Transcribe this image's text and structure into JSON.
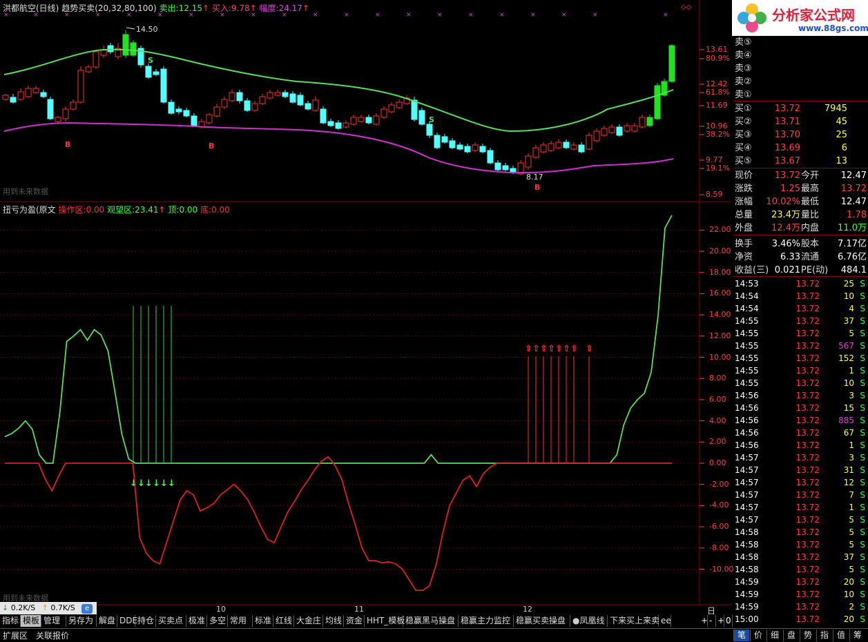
{
  "upper_header": {
    "name": "洪都航空(日线)",
    "indicator": "趋势买卖(20,32,80,100)",
    "sell_label": "卖出:",
    "sell_value": "12.15",
    "buy_label": "买入:",
    "buy_value": "9.78",
    "amp_label": "幅度:",
    "amp_value": "24.17"
  },
  "upper_axis": [
    {
      "label": "13.61",
      "y": 72
    },
    {
      "label": "80.9%",
      "y": 85
    },
    {
      "label": "12.42",
      "y": 122
    },
    {
      "label": "61.8%",
      "y": 134
    },
    {
      "label": "11.69",
      "y": 153
    },
    {
      "label": "10.96",
      "y": 183
    },
    {
      "label": "38.2%",
      "y": 195
    },
    {
      "label": "9.77",
      "y": 232
    },
    {
      "label": "19.1%",
      "y": 244
    },
    {
      "label": "8.59",
      "y": 282
    }
  ],
  "upper_marks": {
    "high_label": "14.50",
    "low_label": "8.17",
    "buy_mark": "B",
    "sell_mark": "S",
    "watermark": "用到未来数据"
  },
  "lower_header": {
    "name": "扭亏为盈(原文",
    "op_label": "操作区:",
    "op_value": "0.00",
    "watch_label": "观望区:",
    "watch_value": "23.41",
    "top_label": "顶:",
    "top_value": "0.00",
    "bottom_label": "底:",
    "bottom_value": "0.00"
  },
  "lower_axis": [
    "22.00",
    "20.00",
    "18.00",
    "16.00",
    "14.00",
    "12.00",
    "10.00",
    "8.00",
    "6.00",
    "4.00",
    "2.00",
    "0.00",
    "-2.00",
    "-4.00",
    "-6.00",
    "-8.00",
    "-10.00"
  ],
  "lower_watermark": "用到未来数据",
  "chart_data": {
    "type": "line",
    "title": "扭亏为盈(原文",
    "series": [
      {
        "name": "观望区",
        "color": "#55e055",
        "values": [
          2.5,
          2.8,
          3.3,
          4,
          3.2,
          0.8,
          0,
          0,
          4.8,
          11.5,
          12,
          12.6,
          11.6,
          12.6,
          12.1,
          10.6,
          6.8,
          2.8,
          0.4,
          0,
          0,
          0,
          0,
          0,
          0,
          0,
          0,
          0,
          0,
          0,
          0,
          0,
          0,
          0,
          0,
          0,
          0,
          0,
          0,
          0,
          0,
          0,
          0,
          0,
          0,
          0,
          0,
          0,
          0,
          0,
          0,
          0,
          0,
          0,
          0,
          0,
          0,
          0,
          0,
          0,
          0,
          0,
          0.8,
          0,
          0,
          0,
          0,
          0,
          0,
          0,
          0,
          0,
          0,
          0,
          0,
          0,
          0,
          0,
          0,
          0,
          0,
          0,
          0,
          0,
          0,
          0,
          0,
          0,
          0,
          0.8,
          3.6,
          5.2,
          6,
          6.6,
          8.6,
          14,
          22.2,
          23.4
        ]
      },
      {
        "name": "操作区",
        "color": "#e02020",
        "values": [
          0,
          0,
          0,
          0,
          0,
          0,
          -1.5,
          -2.6,
          -1.2,
          0,
          0,
          0,
          0,
          0,
          0,
          0,
          0,
          0,
          0,
          0,
          -7,
          -8.5,
          -9.2,
          -9.5,
          -7.5,
          -5.5,
          -3.5,
          -2.6,
          -3,
          -4.5,
          -4.2,
          -3.8,
          -3,
          -2.5,
          -2,
          -2.6,
          -3.4,
          -4.6,
          -6,
          -7.2,
          -7.5,
          -6,
          -4.6,
          -3.6,
          -2.5,
          -1.6,
          -0.6,
          0.2,
          0.6,
          -0.2,
          -1.5,
          -3.8,
          -5.8,
          -8,
          -9.2,
          -9.2,
          -9.4,
          -9.3,
          -9.5,
          -10,
          -11,
          -12,
          -12,
          -11.6,
          -9.6,
          -6.6,
          -4,
          -2.8,
          -1.6,
          -1.2,
          -2.2,
          -1,
          -0.4,
          0,
          0,
          0,
          0,
          0,
          0,
          0,
          0,
          0,
          0,
          0,
          0,
          0,
          0,
          0,
          0,
          0,
          0,
          0,
          0,
          0,
          0,
          0,
          0,
          0,
          0,
          0
        ]
      }
    ],
    "ylim": [
      -12,
      24
    ],
    "sell_signal_count": 6,
    "buy_signal_count": 9
  },
  "right_panel": {
    "sell_orders": [
      "卖⑤",
      "卖④",
      "卖③",
      "卖②",
      "卖①"
    ],
    "buy_orders": [
      {
        "label": "买①",
        "price": "13.72",
        "vol": "7945"
      },
      {
        "label": "买②",
        "price": "13.71",
        "vol": "45"
      },
      {
        "label": "买③",
        "price": "13.70",
        "vol": "25"
      },
      {
        "label": "买④",
        "price": "13.69",
        "vol": "6"
      },
      {
        "label": "买⑤",
        "price": "13.67",
        "vol": "13"
      }
    ],
    "stats": [
      {
        "l1": "现价",
        "v1": "13.72",
        "c1": "#ff4040",
        "l2": "今开",
        "v2": "12.47",
        "c2": "#ffffff"
      },
      {
        "l1": "涨跌",
        "v1": "1.25",
        "c1": "#ff4040",
        "l2": "最高",
        "v2": "13.72",
        "c2": "#ff4040"
      },
      {
        "l1": "涨幅",
        "v1": "10.02%",
        "c1": "#ff4040",
        "l2": "最低",
        "v2": "12.47",
        "c2": "#ffffff"
      },
      {
        "l1": "总量",
        "v1": "23.4万",
        "c1": "#ffff40",
        "l2": "量比",
        "v2": "1.78",
        "c2": "#ff4040"
      },
      {
        "l1": "外盘",
        "v1": "12.4万",
        "c1": "#ff4040",
        "l2": "内盘",
        "v2": "11.0万",
        "c2": "#40ff40"
      },
      {
        "l1": "换手",
        "v1": "3.46%",
        "c1": "#ffffff",
        "l2": "股本",
        "v2": "7.17亿",
        "c2": "#ffffff"
      },
      {
        "l1": "净资",
        "v1": "6.33",
        "c1": "#ffffff",
        "l2": "流通",
        "v2": "6.76亿",
        "c2": "#ffffff"
      },
      {
        "l1": "收益(三)",
        "v1": "0.021",
        "c1": "#ffffff",
        "l2": "PE(动)",
        "v2": "484.1",
        "c2": "#ffffff"
      }
    ],
    "ticks": [
      {
        "t": "14:53",
        "p": "13.72",
        "v": "25",
        "vc": "#ffff40"
      },
      {
        "t": "14:54",
        "p": "13.72",
        "v": "10",
        "vc": "#ffff40"
      },
      {
        "t": "14:54",
        "p": "13.72",
        "v": "4",
        "vc": "#ffff40"
      },
      {
        "t": "14:55",
        "p": "13.72",
        "v": "37",
        "vc": "#ffff40"
      },
      {
        "t": "14:55",
        "p": "13.72",
        "v": "5",
        "vc": "#ffff40"
      },
      {
        "t": "14:55",
        "p": "13.72",
        "v": "567",
        "vc": "#e040e0"
      },
      {
        "t": "14:55",
        "p": "13.72",
        "v": "152",
        "vc": "#ffff40"
      },
      {
        "t": "14:55",
        "p": "13.72",
        "v": "1",
        "vc": "#ffff40"
      },
      {
        "t": "14:55",
        "p": "13.72",
        "v": "10",
        "vc": "#ffff40"
      },
      {
        "t": "14:56",
        "p": "13.72",
        "v": "3",
        "vc": "#ffff40"
      },
      {
        "t": "14:56",
        "p": "13.72",
        "v": "15",
        "vc": "#ffff40"
      },
      {
        "t": "14:56",
        "p": "13.72",
        "v": "885",
        "vc": "#e040e0"
      },
      {
        "t": "14:56",
        "p": "13.72",
        "v": "67",
        "vc": "#ffff40"
      },
      {
        "t": "14:56",
        "p": "13.72",
        "v": "1",
        "vc": "#ffff40"
      },
      {
        "t": "14:57",
        "p": "13.72",
        "v": "3",
        "vc": "#ffff40"
      },
      {
        "t": "14:57",
        "p": "13.72",
        "v": "31",
        "vc": "#ffff40"
      },
      {
        "t": "14:57",
        "p": "13.72",
        "v": "12",
        "vc": "#ffff40"
      },
      {
        "t": "14:57",
        "p": "13.72",
        "v": "7",
        "vc": "#ffff40"
      },
      {
        "t": "14:57",
        "p": "13.72",
        "v": "1",
        "vc": "#ffff40"
      },
      {
        "t": "14:57",
        "p": "13.72",
        "v": "5",
        "vc": "#ffff40"
      },
      {
        "t": "14:58",
        "p": "13.72",
        "v": "5",
        "vc": "#ffff40"
      },
      {
        "t": "14:58",
        "p": "13.72",
        "v": "5",
        "vc": "#ffff40"
      },
      {
        "t": "14:58",
        "p": "13.72",
        "v": "37",
        "vc": "#ffff40"
      },
      {
        "t": "14:58",
        "p": "13.72",
        "v": "5",
        "vc": "#ffff40"
      },
      {
        "t": "14:59",
        "p": "13.72",
        "v": "20",
        "vc": "#ffff40"
      },
      {
        "t": "14:59",
        "p": "13.72",
        "v": "10",
        "vc": "#ffff40"
      },
      {
        "t": "14:59",
        "p": "13.72",
        "v": "2",
        "vc": "#ffff40"
      },
      {
        "t": "15:00",
        "p": "13.72",
        "v": "20",
        "vc": "#ffff40"
      }
    ],
    "tick_flag": "S"
  },
  "date_labels": [
    "10",
    "11",
    "12"
  ],
  "period_label": "日线",
  "speed": {
    "down": "0.2K/S",
    "up": "0.7K/S"
  },
  "tabs": [
    "指标",
    "模板",
    "管理",
    "另存为",
    "解盘",
    "DDE",
    "持仓",
    "买卖点",
    "极准",
    "多空",
    "常用",
    "标准",
    "红线",
    "大金庄",
    "均线",
    "资金",
    "HHT_模板",
    "稳赢黑马操盘",
    "稳赢主力监控",
    "稳赢买卖操盘",
    "凤凰线",
    "下来买上来卖",
    "ee"
  ],
  "active_tab": "模板",
  "tab_nav": [
    "+",
    "-",
    "+",
    "0"
  ],
  "bottom_left": [
    "扩展区",
    "关联报价"
  ],
  "right_tabs": [
    "笔",
    "价",
    "细",
    "盘",
    "势",
    "指",
    "值",
    "筹"
  ],
  "logo": {
    "text": "分析家公式网",
    "url": "www.88gs.com"
  },
  "colors": {
    "up": "#ff3030",
    "down": "#54ffff",
    "ma_upper": "#55e055",
    "ma_lower": "#e040e0",
    "grid": "#8b0000"
  }
}
